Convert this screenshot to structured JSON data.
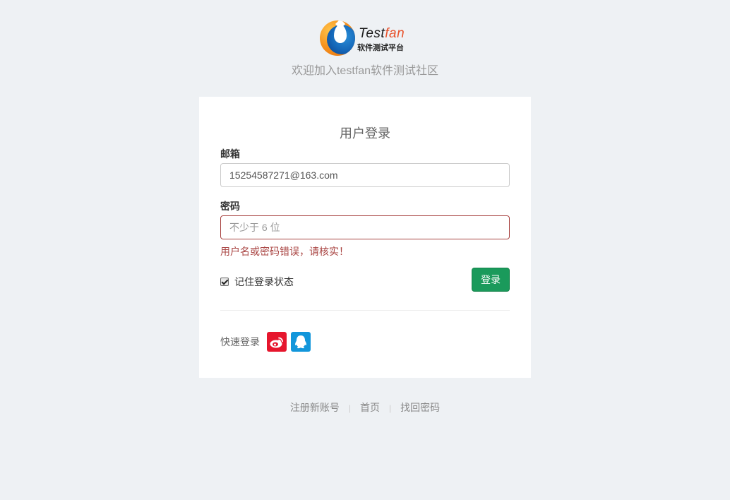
{
  "logo": {
    "brand_prefix": "Test",
    "brand_suffix": "fan",
    "subtitle": "软件测试平台"
  },
  "welcome_text": "欢迎加入testfan软件测试社区",
  "login_card": {
    "title": "用户登录",
    "email_label": "邮箱",
    "email_value": "15254587271@163.com",
    "password_label": "密码",
    "password_placeholder": "不少于 6 位",
    "error_message": "用户名或密码错误，请核实！",
    "remember_label": "记住登录状态",
    "remember_checked": true,
    "login_button": "登录",
    "quick_login_label": "快速登录",
    "quick_login_providers": [
      "weibo-icon",
      "qq-icon"
    ]
  },
  "footer": {
    "links": [
      "注册新账号",
      "首页",
      "找回密码"
    ],
    "separator": "|"
  },
  "colors": {
    "background": "#eef1f4",
    "primary_button": "#1a9a5b",
    "error": "#a94442",
    "weibo": "#e6162d",
    "qq": "#1296db"
  }
}
